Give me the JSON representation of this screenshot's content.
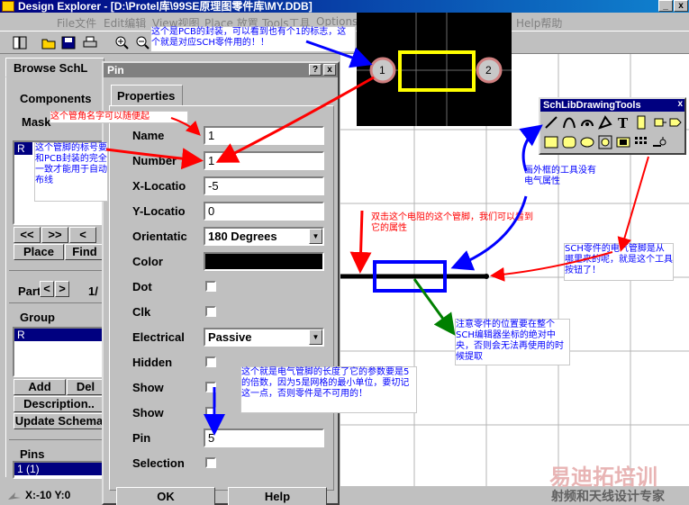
{
  "window": {
    "title": "Design Explorer - [D:\\Protel库\\99SE原理图零件库\\MY.DDB]",
    "minimize": "_",
    "close": "x"
  },
  "menubar": [
    {
      "label": "File文件"
    },
    {
      "label": "Edit编辑"
    },
    {
      "label": "View视图"
    },
    {
      "label": "Place 放置"
    },
    {
      "label": "Tools工具"
    },
    {
      "label": "Options"
    },
    {
      "label": "Help帮助"
    }
  ],
  "left_panel": {
    "tab": "Browse SchL",
    "components_label": "Components",
    "mask_label": "Mask",
    "component_item": "R",
    "nav_buttons": [
      "<<",
      ">>",
      "<"
    ],
    "place_button": "Place",
    "find_button": "Find",
    "part_label": "Part",
    "part_prev": "<",
    "part_next": ">",
    "part_value": "1/",
    "group_label": "Group",
    "group_item": "R",
    "add_button": "Add",
    "del_button": "Del",
    "description_button": "Description..",
    "update_button": "Update Schema",
    "pins_label": "Pins",
    "pins_item": "1  (1)"
  },
  "status": {
    "coords": "X:-10 Y:0"
  },
  "pin_dialog": {
    "title": "Pin",
    "help_btn": "?",
    "close_btn": "x",
    "tab": "Properties",
    "labels": {
      "name": "Name",
      "number": "Number",
      "x_location": "X-Locatio",
      "y_location": "Y-Locatio",
      "orientation": "Orientatic",
      "color": "Color",
      "dot": "Dot",
      "clk": "Clk",
      "electrical": "Electrical",
      "hidden": "Hidden",
      "show_name": "Show",
      "show_number": "Show",
      "pin_length": "Pin",
      "selection": "Selection"
    },
    "values": {
      "name": "1",
      "number": "1",
      "x_location": "-5",
      "y_location": "0",
      "orientation": "180 Degrees",
      "electrical": "Passive",
      "pin_length": "5"
    },
    "ok_button": "OK",
    "help_button": "Help"
  },
  "pcb_preview": {
    "pad1": "1",
    "pad2": "2"
  },
  "tools_palette": {
    "title": "SchLibDrawingTools"
  },
  "annotations": {
    "pcb_footprint": "这个是PCB的封装，可以看到也有个1的标志，这个就是对应SCH零件用的！！",
    "pin_name": "这个管角名字可以随便起",
    "pin_number": "这个管脚的标号要和PCB封装的完全一致才能用于自动布线",
    "double_click": "双击这个电阻的这个管脚，我们可以看到它的属性",
    "outline_tool": "画外框的工具没有电气属性",
    "pin_tool": "SCH零件的电气管脚是从哪里来的呢，就是这个工具按钮了！",
    "origin_note": "注意零件的位置要在整个SCH编辑器坐标的绝对中央，否则会无法再使用的时候提取",
    "pin_length_note": "这个就是电气管脚的长度了它的参数要是5的倍数，因为5是网格的最小单位，要切记这一点，否则零件是不可用的！"
  },
  "watermark": {
    "brand": "易迪拓培训",
    "tagline": "射频和天线设计专家"
  },
  "colors": {
    "title_bar": "#000080",
    "selection": "#000080",
    "pcb_outline": "#ffff00",
    "pin_highlight": "#0000ff",
    "annotation_red": "#ff0000",
    "annotation_blue": "#0000ff",
    "annotation_green": "#008000"
  }
}
